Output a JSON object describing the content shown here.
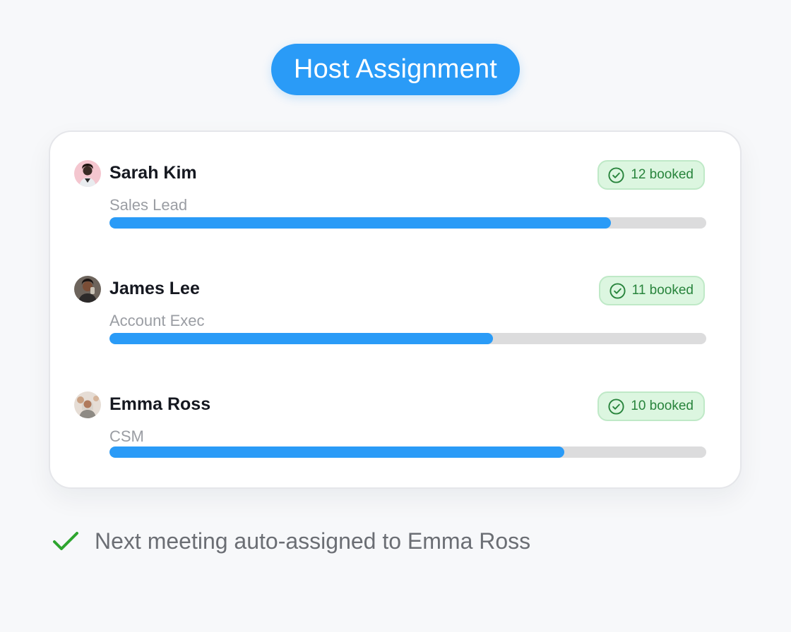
{
  "title": "Host Assignment",
  "hosts": [
    {
      "name": "Sarah Kim",
      "role": "Sales Lead",
      "booked": "12 booked",
      "load_fraction": 0.84,
      "avatar_icon": "avatar-photo-sarah-kim"
    },
    {
      "name": "James Lee",
      "role": "Account Exec",
      "booked": "11 booked",
      "load_fraction": 0.643,
      "avatar_icon": "avatar-photo-james-lee"
    },
    {
      "name": "Emma Ross",
      "role": "CSM",
      "booked": "10 booked",
      "load_fraction": 0.762,
      "avatar_icon": "avatar-photo-emma-ross"
    }
  ],
  "footer": {
    "message": "Next meeting auto-assigned to Emma Ross",
    "icon": "checkmark-icon"
  },
  "colors": {
    "accent": "#2a9bf7",
    "track": "#dcdcdd",
    "badge_bg": "#dcf6e0",
    "badge_text": "#28843c",
    "success_check": "#2ea52f"
  }
}
